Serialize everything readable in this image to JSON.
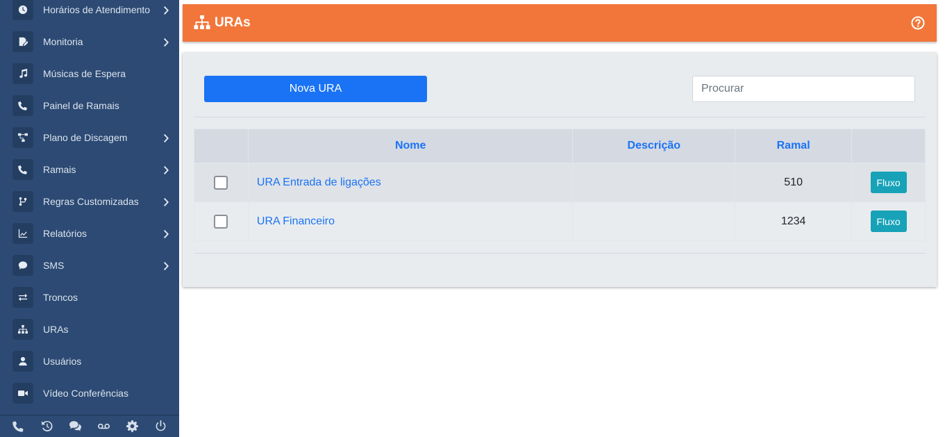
{
  "sidebar": {
    "items": [
      {
        "label": "Horários de Atendimento",
        "icon": "clock-icon",
        "has_submenu": true
      },
      {
        "label": "Monitoria",
        "icon": "edit-document-icon",
        "has_submenu": true
      },
      {
        "label": "Músicas de Espera",
        "icon": "music-note-icon",
        "has_submenu": false
      },
      {
        "label": "Painel de Ramais",
        "icon": "phone-icon",
        "has_submenu": false
      },
      {
        "label": "Plano de Discagem",
        "icon": "network-nodes-icon",
        "has_submenu": true
      },
      {
        "label": "Ramais",
        "icon": "phone-icon",
        "has_submenu": true
      },
      {
        "label": "Regras Customizadas",
        "icon": "code-branch-icon",
        "has_submenu": true
      },
      {
        "label": "Relatórios",
        "icon": "line-chart-icon",
        "has_submenu": true
      },
      {
        "label": "SMS",
        "icon": "chat-bubble-icon",
        "has_submenu": true
      },
      {
        "label": "Troncos",
        "icon": "exchange-arrows-icon",
        "has_submenu": false
      },
      {
        "label": "URAs",
        "icon": "sitemap-icon",
        "has_submenu": false
      },
      {
        "label": "Usuários",
        "icon": "user-icon",
        "has_submenu": false
      },
      {
        "label": "Vídeo Conferências",
        "icon": "video-camera-icon",
        "has_submenu": false
      }
    ],
    "footer_icons": [
      "phone-icon",
      "history-icon",
      "comments-icon",
      "voicemail-icon",
      "gear-icon",
      "power-icon"
    ]
  },
  "header": {
    "title": "URAs",
    "icon": "sitemap-icon",
    "help_icon": "question-circle-icon",
    "color": "#f2763a"
  },
  "toolbar": {
    "new_button_label": "Nova URA",
    "search_placeholder": "Procurar"
  },
  "table": {
    "columns": [
      "",
      "Nome",
      "Descrição",
      "Ramal",
      ""
    ],
    "rows": [
      {
        "name": "URA Entrada de ligações",
        "description": "",
        "ramal": "510",
        "action_label": "Fluxo"
      },
      {
        "name": "URA Financeiro",
        "description": "",
        "ramal": "1234",
        "action_label": "Fluxo"
      }
    ]
  },
  "colors": {
    "sidebar": "#2c4a73",
    "primary": "#1a73f5",
    "info": "#17a2b8"
  }
}
